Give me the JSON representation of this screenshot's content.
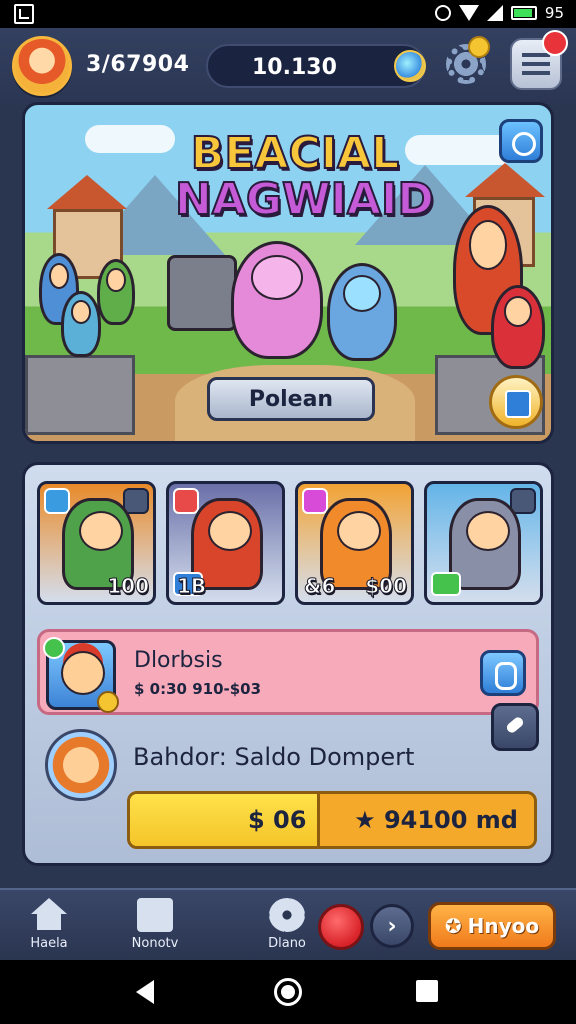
{
  "status_bar": {
    "battery": "95",
    "icons": [
      "screenshot-icon",
      "alarm-icon",
      "wifi-icon",
      "signal-icon",
      "battery-icon"
    ]
  },
  "hud": {
    "player_score": "3/67904",
    "coins": "10.130",
    "icons": [
      "avatar",
      "gem-icon",
      "gear-icon",
      "menu-icon",
      "notification-badge"
    ]
  },
  "hero": {
    "title_line1": "BEACIAL",
    "title_line2": "NAGWIAID",
    "button_label": "Polean"
  },
  "cards": [
    {
      "value": "100",
      "bg": "#e88a2a"
    },
    {
      "value": "1B",
      "bg": "#6a6fa8"
    },
    {
      "value": "$00",
      "bg": "#f2a234"
    },
    {
      "value": "",
      "bg": "#63b4e8"
    }
  ],
  "card_extras": {
    "card3_prefix": "&6"
  },
  "row1": {
    "name": "Dlorbsis",
    "sub": "$ 0:30 910-$03"
  },
  "row2": {
    "title": "Bahdor: Saldo Dompert",
    "progress_left": "$ 06",
    "progress_right": "★ 94100 md",
    "progress_fraction": 0.47
  },
  "bottom_nav": {
    "home": "Haela",
    "gifts": "Nonotv",
    "settings": "Dlano",
    "next": "›",
    "cta": "Hnyoo"
  },
  "colors": {
    "accent_orange": "#f07a1c",
    "progress_yellow": "#ffe14a",
    "pink_row": "#f7aab9",
    "brand_blue": "#2f7ed8"
  }
}
